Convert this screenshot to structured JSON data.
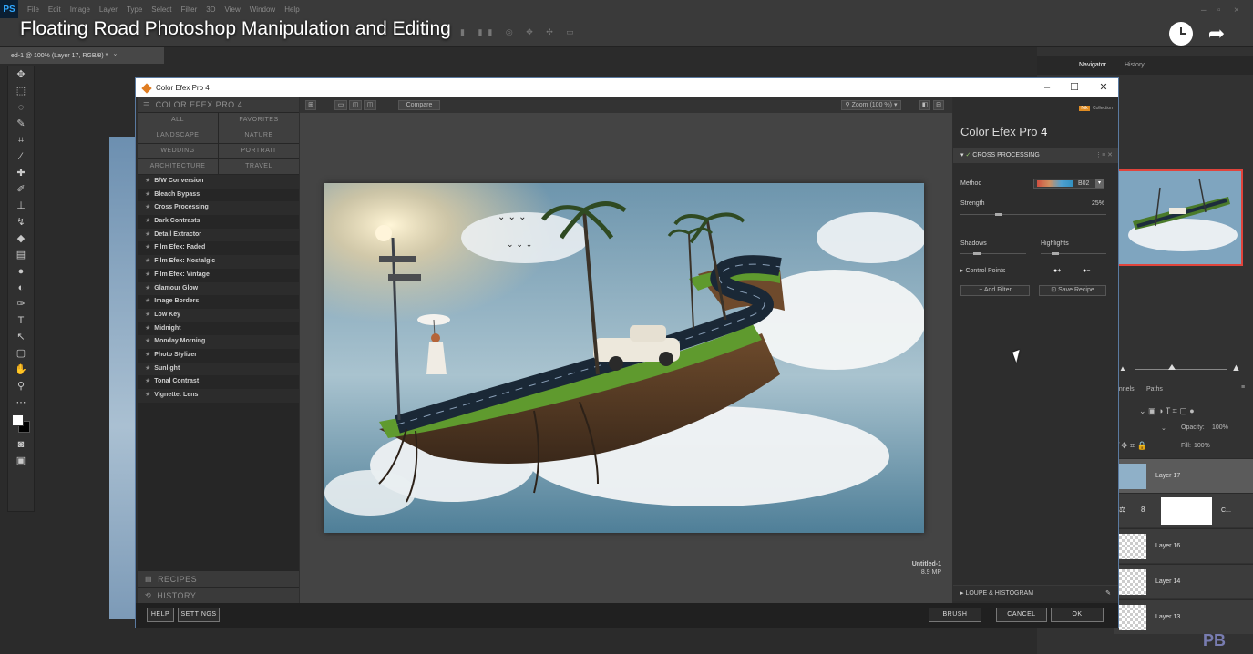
{
  "video": {
    "title": "Floating Road Photoshop Manipulation and Editing"
  },
  "photoshop": {
    "logo": "PS",
    "menu": [
      "File",
      "Edit",
      "Image",
      "Layer",
      "Type",
      "Select",
      "Filter",
      "3D",
      "View",
      "Window",
      "Help"
    ],
    "document_tab": "ed-1 @ 100% (Layer 17, RGB/8) *",
    "panel_tabs": [
      "Navigator",
      "History"
    ],
    "layers_tabs": [
      "annels",
      "Paths"
    ],
    "opacity_label": "Opacity:",
    "opacity_value": "100%",
    "fill_label": "Fill:",
    "fill_value": "100%",
    "layers": [
      {
        "name": "Layer 17",
        "selected": true
      },
      {
        "name": "C...",
        "selected": false
      },
      {
        "name": "Layer 16",
        "selected": false
      },
      {
        "name": "Layer 14",
        "selected": false
      },
      {
        "name": "Layer 13",
        "selected": false
      }
    ]
  },
  "efex": {
    "window_title": "Color Efex Pro 4",
    "left_header": "COLOR EFEX PRO 4",
    "categories": [
      "ALL",
      "FAVORITES",
      "LANDSCAPE",
      "NATURE",
      "WEDDING",
      "PORTRAIT",
      "ARCHITECTURE",
      "TRAVEL"
    ],
    "filters": [
      "B/W Conversion",
      "Bleach Bypass",
      "Cross Processing",
      "Dark Contrasts",
      "Detail Extractor",
      "Film Efex: Faded",
      "Film Efex: Nostalgic",
      "Film Efex: Vintage",
      "Glamour Glow",
      "Image Borders",
      "Low Key",
      "Midnight",
      "Monday Morning",
      "Photo Stylizer",
      "Sunlight",
      "Tonal Contrast",
      "Vignette: Lens"
    ],
    "recipes_label": "RECIPES",
    "history_label": "HISTORY",
    "compare_label": "Compare",
    "zoom_label": "Zoom (100 %)",
    "image_name": "Untitled-1",
    "image_size": "8.9 MP",
    "brand": "Collection",
    "product_name": "Color Efex Pro",
    "product_version": "4",
    "active_filter": "CROSS PROCESSING",
    "method_label": "Method",
    "method_value": "B02",
    "strength_label": "Strength",
    "strength_value": "25%",
    "shadows_label": "Shadows",
    "highlights_label": "Highlights",
    "control_points_label": "Control Points",
    "add_filter_label": "Add Filter",
    "save_recipe_label": "Save Recipe",
    "loupe_label": "LOUPE & HISTOGRAM",
    "help_label": "HELP",
    "settings_label": "SETTINGS",
    "brush_label": "BRUSH",
    "cancel_label": "CANCEL",
    "ok_label": "OK"
  },
  "colors": {
    "accent_orange": "#e08c22",
    "selection_red": "#e0443c"
  }
}
